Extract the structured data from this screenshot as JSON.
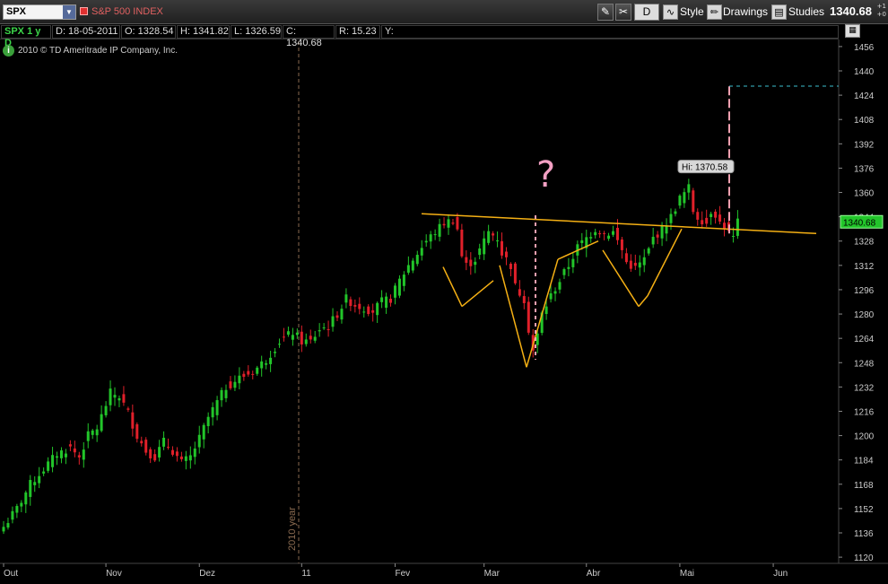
{
  "toolbar": {
    "symbol": "SPX",
    "description": "S&P 500 INDEX",
    "period": "D",
    "style_label": "Style",
    "drawings_label": "Drawings",
    "studies_label": "Studies",
    "last_price": "1340.68",
    "net_change_a": "+1",
    "net_change_b": "+0"
  },
  "infobar": {
    "symbol_period": "SPX 1 y D",
    "date": "D: 18-05-2011",
    "open": "O: 1328.54",
    "high": "H: 1341.82",
    "low": "L: 1326.59",
    "close": "C: 1340.68",
    "range": "R: 15.23",
    "yield": "Y:"
  },
  "copyright": "2010 © TD Ameritrade IP Company, Inc.",
  "colors": {
    "up": "#22c52a",
    "down": "#e0202a",
    "pattern": "#f5b014",
    "price_label": "#22c52a"
  },
  "chart_data": {
    "type": "candlestick",
    "y_ticks": [
      "1456",
      "1440",
      "1424",
      "1408",
      "1392",
      "1376",
      "1360",
      "1344",
      "1328",
      "1312",
      "1296",
      "1280",
      "1264",
      "1248",
      "1232",
      "1216",
      "1200",
      "1184",
      "1168",
      "1152",
      "1136",
      "1120"
    ],
    "ylim": [
      1120,
      1456
    ],
    "x_labels": [
      "Out",
      "Nov",
      "Dez",
      "11",
      "Fev",
      "Mar",
      "Abr",
      "Mai",
      "Jun"
    ],
    "year_marker": "2010 year",
    "hi_label": "Hi: 1370.58",
    "last_label": "1340.68",
    "question_mark": "?",
    "target_price": 1430,
    "neckline": [
      1346,
      1333
    ],
    "anchors": [
      [
        0,
        1140
      ],
      [
        3,
        1152
      ],
      [
        6,
        1168
      ],
      [
        9,
        1178
      ],
      [
        12,
        1188
      ],
      [
        15,
        1192
      ],
      [
        17,
        1186
      ],
      [
        19,
        1200
      ],
      [
        21,
        1205
      ],
      [
        24,
        1228
      ],
      [
        26,
        1226
      ],
      [
        28,
        1215
      ],
      [
        30,
        1200
      ],
      [
        32,
        1190
      ],
      [
        34,
        1186
      ],
      [
        36,
        1196
      ],
      [
        38,
        1190
      ],
      [
        40,
        1182
      ],
      [
        42,
        1186
      ],
      [
        44,
        1198
      ],
      [
        46,
        1212
      ],
      [
        48,
        1222
      ],
      [
        50,
        1232
      ],
      [
        53,
        1238
      ],
      [
        56,
        1242
      ],
      [
        59,
        1250
      ],
      [
        62,
        1262
      ],
      [
        65,
        1268
      ],
      [
        67,
        1262
      ],
      [
        69,
        1262
      ],
      [
        71,
        1270
      ],
      [
        73,
        1272
      ],
      [
        75,
        1280
      ],
      [
        77,
        1290
      ],
      [
        79,
        1286
      ],
      [
        81,
        1284
      ],
      [
        83,
        1282
      ],
      [
        85,
        1288
      ],
      [
        87,
        1290
      ],
      [
        89,
        1302
      ],
      [
        91,
        1312
      ],
      [
        93,
        1320
      ],
      [
        95,
        1328
      ],
      [
        97,
        1334
      ],
      [
        99,
        1340
      ],
      [
        101,
        1342
      ],
      [
        102,
        1336
      ],
      [
        103,
        1318
      ],
      [
        104,
        1312
      ],
      [
        106,
        1316
      ],
      [
        107,
        1322
      ],
      [
        109,
        1334
      ],
      [
        111,
        1330
      ],
      [
        112,
        1320
      ],
      [
        114,
        1312
      ],
      [
        115,
        1298
      ],
      [
        117,
        1290
      ],
      [
        118,
        1270
      ],
      [
        119,
        1256
      ],
      [
        120,
        1266
      ],
      [
        121,
        1280
      ],
      [
        123,
        1292
      ],
      [
        125,
        1302
      ],
      [
        127,
        1312
      ],
      [
        129,
        1324
      ],
      [
        131,
        1330
      ],
      [
        133,
        1336
      ],
      [
        135,
        1333
      ],
      [
        137,
        1334
      ],
      [
        139,
        1322
      ],
      [
        140,
        1314
      ],
      [
        142,
        1310
      ],
      [
        144,
        1316
      ],
      [
        145,
        1322
      ],
      [
        146,
        1330
      ],
      [
        148,
        1336
      ],
      [
        150,
        1344
      ],
      [
        152,
        1356
      ],
      [
        154,
        1363
      ],
      [
        155,
        1348
      ],
      [
        156,
        1344
      ],
      [
        158,
        1340
      ],
      [
        159,
        1348
      ],
      [
        160,
        1346
      ],
      [
        161,
        1340
      ],
      [
        162,
        1338
      ],
      [
        163,
        1333
      ],
      [
        164,
        1330
      ],
      [
        165,
        1340
      ]
    ]
  }
}
